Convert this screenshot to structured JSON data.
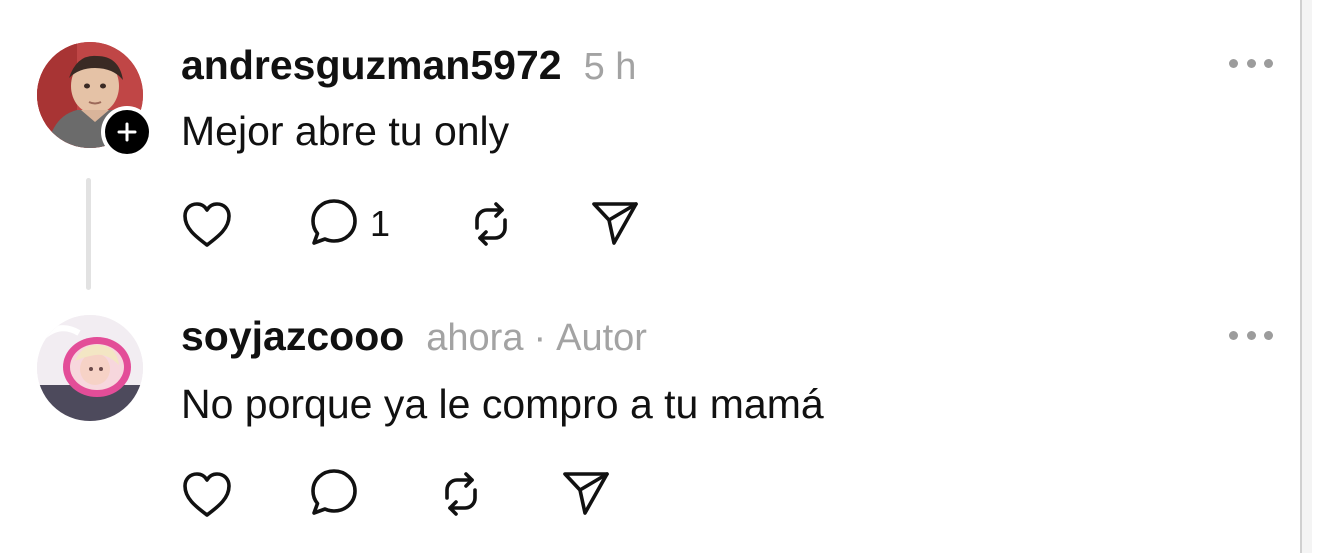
{
  "comments": [
    {
      "username": "andresguzman5972",
      "time": "5 h",
      "text": "Mejor abre tu only",
      "reply_count": "1"
    },
    {
      "username": "soyjazcooo",
      "time": "ahora",
      "separator": "·",
      "badge": "Autor",
      "text": "No porque ya le compro a tu mamá"
    }
  ],
  "icons": {
    "like": "heart-icon",
    "reply": "comment-icon",
    "repost": "repost-icon",
    "share": "send-icon",
    "more": "more-icon",
    "follow": "plus-icon"
  },
  "colors": {
    "text": "#111111",
    "muted": "#a3a3a3",
    "badge": "#000000"
  }
}
